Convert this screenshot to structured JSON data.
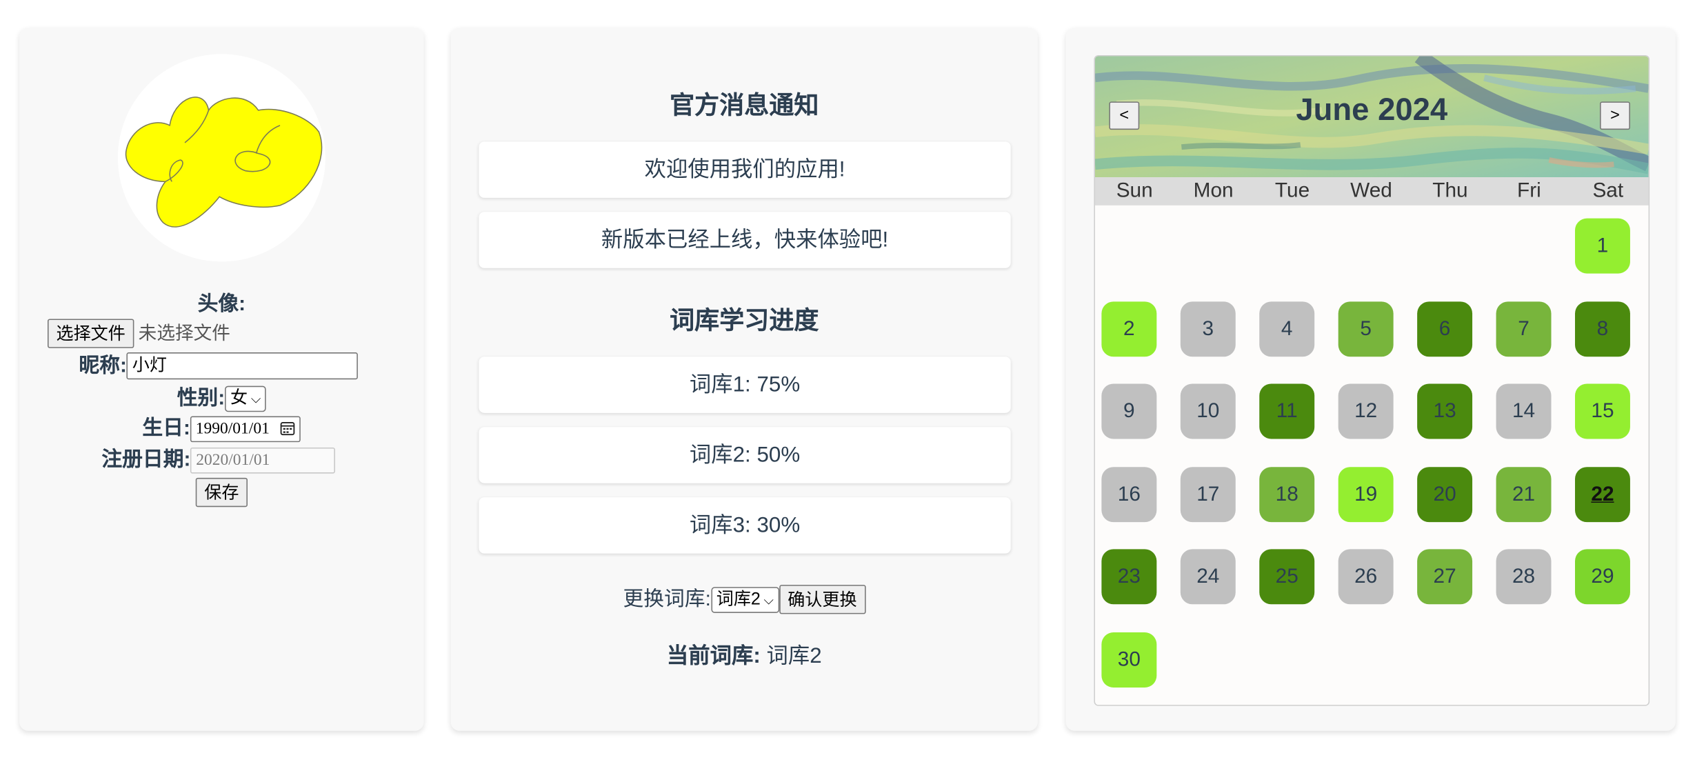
{
  "profile": {
    "avatar_label": "头像:",
    "file_button": "选择文件",
    "file_status": "未选择文件",
    "nickname_label": "昵称:",
    "nickname_value": "小灯",
    "gender_label": "性别:",
    "gender_value": "女",
    "birthday_label": "生日:",
    "birthday_value": "1990/01/01",
    "register_label": "注册日期:",
    "register_value": "2020/01/01",
    "save_button": "保存"
  },
  "notice": {
    "title": "官方消息通知",
    "messages": [
      "欢迎使用我们的应用!",
      "新版本已经上线，快来体验吧!"
    ]
  },
  "progress": {
    "title": "词库学习进度",
    "items": [
      "词库1: 75%",
      "词库2: 50%",
      "词库3: 30%"
    ],
    "switch_label": "更换词库:",
    "switch_value": "词库2",
    "confirm_button": "确认更换",
    "current_label": "当前词库:",
    "current_value": "词库2"
  },
  "calendar": {
    "title": "June 2024",
    "prev_button": "<",
    "next_button": ">",
    "weekdays": [
      "Sun",
      "Mon",
      "Tue",
      "Wed",
      "Thu",
      "Fri",
      "Sat"
    ],
    "first_weekday_index": 6,
    "days_in_month": 30,
    "today": 22,
    "level_colors": {
      "none": "#c0c0c0",
      "bright": "#94ee30",
      "bright2": "#7dd62c",
      "medium": "#78b53c",
      "dark": "#4b8a0e"
    },
    "day_levels": [
      "bright",
      "bright",
      "none",
      "none",
      "medium",
      "dark",
      "medium",
      "dark",
      "none",
      "none",
      "dark",
      "none",
      "dark",
      "none",
      "bright",
      "none",
      "none",
      "medium",
      "bright",
      "dark",
      "medium",
      "dark",
      "dark",
      "none",
      "dark",
      "none",
      "medium",
      "none",
      "bright2",
      "bright"
    ]
  }
}
